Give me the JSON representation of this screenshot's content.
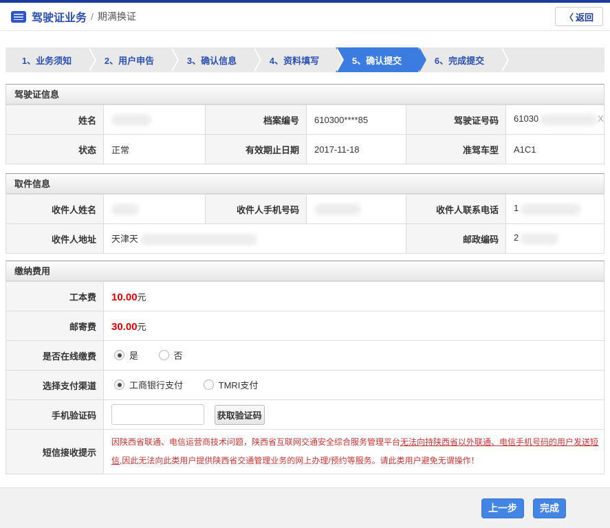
{
  "header": {
    "title": "驾驶证业务",
    "separator": "/",
    "subtitle": "期满换证",
    "back_chevron": "〈",
    "back_label": "返回"
  },
  "steps": [
    {
      "label": "1、业务须知"
    },
    {
      "label": "2、用户申告"
    },
    {
      "label": "3、确认信息"
    },
    {
      "label": "4、资料填写"
    },
    {
      "label": "5、确认提交"
    },
    {
      "label": "6、完成提交"
    }
  ],
  "license": {
    "title": "驾驶证信息",
    "name_label": "姓名",
    "file_no_label": "档案编号",
    "file_no_value": "610300****85",
    "license_no_label": "驾驶证号码",
    "license_no_prefix": "61030",
    "license_no_suffix": "X",
    "status_label": "状态",
    "status_value": "正常",
    "expiry_label": "有效期止日期",
    "expiry_value": "2017-11-18",
    "class_label": "准驾车型",
    "class_value": "A1C1"
  },
  "pickup": {
    "title": "取件信息",
    "recipient_name_label": "收件人姓名",
    "recipient_mobile_label": "收件人手机号码",
    "recipient_phone_label": "收件人联系电话",
    "recipient_phone_prefix": "1",
    "address_label": "收件人地址",
    "address_prefix": "天津天",
    "postcode_label": "邮政编码",
    "postcode_prefix": "2"
  },
  "payment": {
    "title": "缴纳费用",
    "work_fee_label": "工本费",
    "work_fee_value": "10.00",
    "work_fee_unit": "元",
    "mail_fee_label": "邮寄费",
    "mail_fee_value": "30.00",
    "mail_fee_unit": "元",
    "online_label": "是否在线缴费",
    "online_yes": "是",
    "online_no": "否",
    "channel_label": "选择支付渠道",
    "channel_icbc": "工商银行支付",
    "channel_tmri": "TMRI支付",
    "code_label": "手机验证码",
    "code_button": "获取验证码",
    "notice_label": "短信接收提示",
    "notice_pre": "因陕西省联通、电信运营商技术问题，陕西省互联网交通安全综合服务管理平台",
    "notice_underline": "无法向持陕西省以外联通、电信手机号码的用户发送短信,",
    "notice_post": "因此无法向此类用户提供陕西省交通管理业务的网上办理/预约等服务。请此类用户避免无谓操作！"
  },
  "footer": {
    "prev_label": "上一步",
    "finish_label": "完成"
  }
}
